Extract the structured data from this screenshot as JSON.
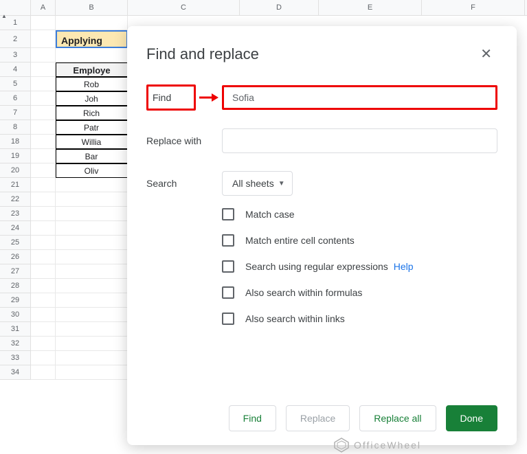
{
  "columns": [
    "A",
    "B",
    "C",
    "D",
    "E",
    "F"
  ],
  "row_numbers": [
    "1",
    "2",
    "3",
    "4",
    "5",
    "6",
    "7",
    "8",
    "18",
    "19",
    "20",
    "21",
    "22",
    "23",
    "24",
    "25",
    "26",
    "27",
    "28",
    "29",
    "30",
    "31",
    "32",
    "33",
    "34"
  ],
  "sheet": {
    "title": "Applying",
    "header": "Employe",
    "data": [
      "Rob",
      "Joh",
      "Rich",
      "Patr",
      "Willia",
      "Bar",
      "Oliv"
    ]
  },
  "dialog": {
    "title": "Find and replace",
    "find_label": "Find",
    "find_value": "Sofia",
    "replace_label": "Replace with",
    "replace_value": "",
    "search_label": "Search",
    "search_scope": "All sheets",
    "checks": {
      "match_case": "Match case",
      "match_entire": "Match entire cell contents",
      "regex": "Search using regular expressions",
      "regex_help": "Help",
      "formulas": "Also search within formulas",
      "links": "Also search within links"
    },
    "buttons": {
      "find": "Find",
      "replace": "Replace",
      "replace_all": "Replace all",
      "done": "Done"
    }
  },
  "watermark": "OfficeWheel"
}
